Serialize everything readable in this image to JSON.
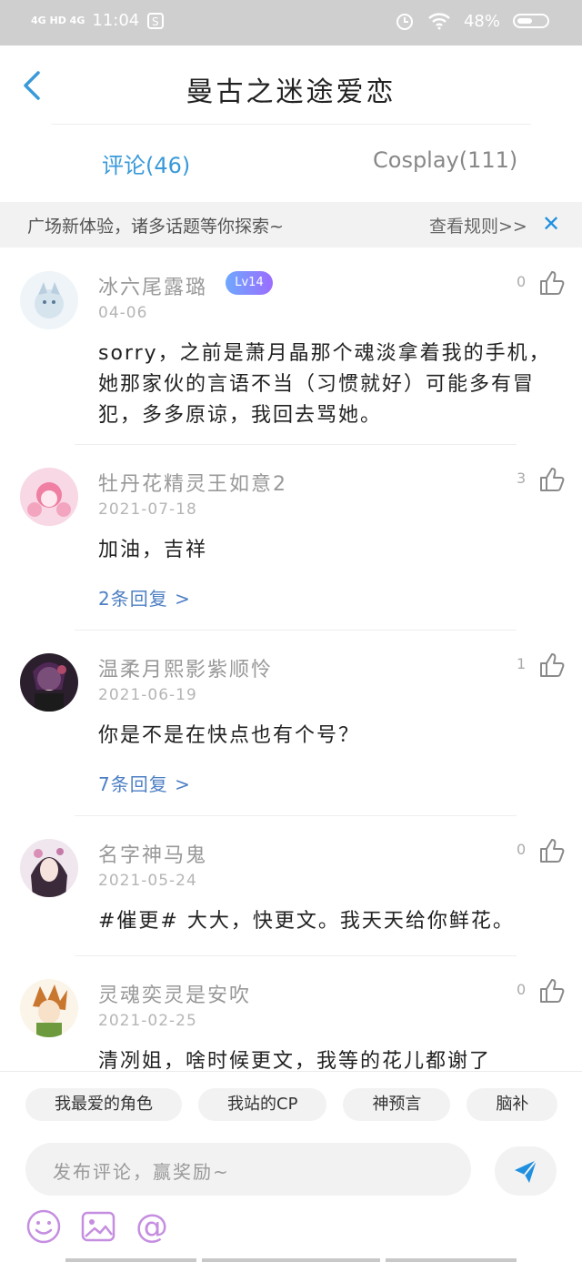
{
  "status": {
    "net": "4G HD 4G",
    "time": "11:04",
    "battery": "48%"
  },
  "header": {
    "title": "曼古之迷途爱恋"
  },
  "tabs": [
    {
      "label": "评论(46)"
    },
    {
      "label": "Cosplay(111)"
    }
  ],
  "notice": {
    "text": "广场新体验，诸多话题等你探索~",
    "link": "查看规则>>",
    "close": "✕"
  },
  "comments": [
    {
      "user": "冰六尾露璐",
      "badge": "Lv14",
      "date": "04-06",
      "likes": "0",
      "text": "sorry，之前是萧月晶那个魂淡拿着我的手机，她那家伙的言语不当（习惯就好）可能多有冒犯，多多原谅，我回去骂她。",
      "replies": ""
    },
    {
      "user": "牡丹花精灵王如意2",
      "badge": "",
      "date": "2021-07-18",
      "likes": "3",
      "text": "加油，吉祥",
      "replies": "2条回复 >"
    },
    {
      "user": "温柔月熙影紫顺怜",
      "badge": "",
      "date": "2021-06-19",
      "likes": "1",
      "text": "你是不是在快点也有个号？",
      "replies": "7条回复 >"
    },
    {
      "user": "名字神马鬼",
      "badge": "",
      "date": "2021-05-24",
      "likes": "0",
      "text": "#催更# 大大，快更文。我天天给你鲜花。",
      "replies": ""
    },
    {
      "user": "灵魂奕灵是安吹",
      "badge": "",
      "date": "2021-02-25",
      "likes": "0",
      "text": "清冽姐，啥时候更文，我等的花儿都谢了",
      "replies": ""
    }
  ],
  "chips": [
    "我最爱的角色",
    "我站的CP",
    "神预言",
    "脑补"
  ],
  "composer": {
    "placeholder": "发布评论，赢奖励~"
  },
  "colors": {
    "accent": "#3a9ad9",
    "link": "#4d7fc4",
    "close": "#1f8fe0",
    "tool": "#c58ee0"
  }
}
